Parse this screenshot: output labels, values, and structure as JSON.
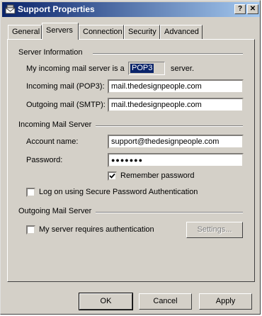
{
  "window": {
    "title": "Support Properties",
    "help_button": "?",
    "close_button": "✕"
  },
  "tabs": [
    {
      "label": "General",
      "active": false
    },
    {
      "label": "Servers",
      "active": true
    },
    {
      "label": "Connection",
      "active": false
    },
    {
      "label": "Security",
      "active": false
    },
    {
      "label": "Advanced",
      "active": false
    }
  ],
  "server_information": {
    "group_title": "Server Information",
    "incoming_prefix": "My incoming mail server is a",
    "server_type": "POP3",
    "incoming_suffix": "server.",
    "incoming_label": "Incoming mail (POP3):",
    "incoming_value": "mail.thedesignpeople.com",
    "outgoing_label": "Outgoing mail (SMTP):",
    "outgoing_value": "mail.thedesignpeople.com"
  },
  "incoming_mail_server": {
    "group_title": "Incoming Mail Server",
    "account_label": "Account name:",
    "account_value": "support@thedesignpeople.com",
    "password_label": "Password:",
    "password_value": "●●●●●●●",
    "remember_label": "Remember password",
    "remember_checked": true,
    "spa_label": "Log on using Secure Password Authentication",
    "spa_checked": false
  },
  "outgoing_mail_server": {
    "group_title": "Outgoing Mail Server",
    "auth_label": "My server requires authentication",
    "auth_checked": false,
    "settings_button": "Settings..."
  },
  "footer": {
    "ok": "OK",
    "cancel": "Cancel",
    "apply": "Apply"
  },
  "colors": {
    "face": "#d4d0c8",
    "title_start": "#0a246a",
    "title_end": "#a6caf0",
    "selection": "#0a246a"
  }
}
